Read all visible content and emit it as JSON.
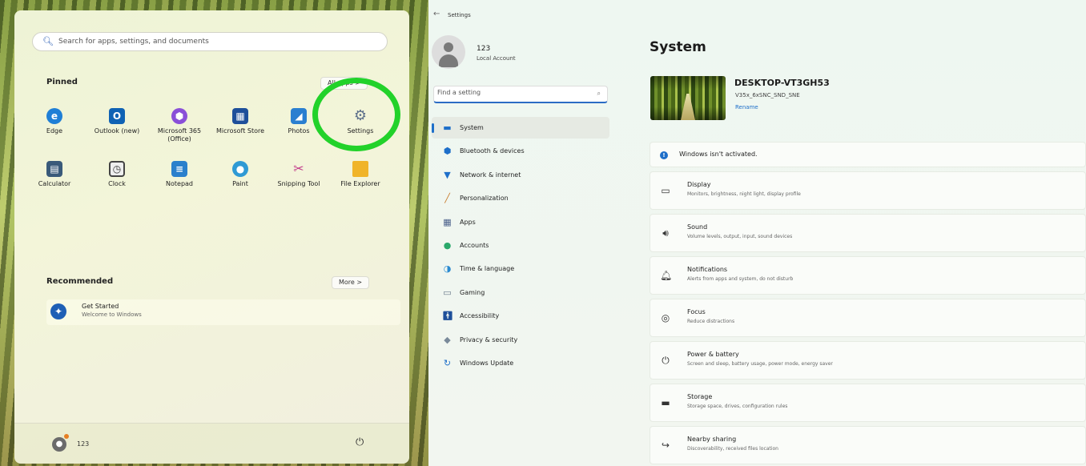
{
  "start_menu": {
    "search_placeholder": "Search for apps, settings, and documents",
    "pinned_title": "Pinned",
    "all_apps_label": "All apps >",
    "pinned_apps": [
      {
        "label": "Edge",
        "icon": "edge-icon",
        "color": "#1f7fd6"
      },
      {
        "label": "Outlook (new)",
        "icon": "outlook-icon",
        "color": "#0f62b4"
      },
      {
        "label": "Microsoft 365 (Office)",
        "icon": "office-icon",
        "color": "#8a4fd8"
      },
      {
        "label": "Microsoft Store",
        "icon": "store-icon",
        "color": "#1e4f9a"
      },
      {
        "label": "Photos",
        "icon": "photos-icon",
        "color": "#2a7fd0"
      },
      {
        "label": "Settings",
        "icon": "gear-icon",
        "color": "#5c6f8a"
      },
      {
        "label": "Calculator",
        "icon": "calculator-icon",
        "color": "#3a5a7a"
      },
      {
        "label": "Clock",
        "icon": "clock-icon",
        "color": "#3b3b3b"
      },
      {
        "label": "Notepad",
        "icon": "notepad-icon",
        "color": "#2b80cc"
      },
      {
        "label": "Paint",
        "icon": "paint-icon",
        "color": "#2f9ad4"
      },
      {
        "label": "Snipping Tool",
        "icon": "snipping-tool-icon",
        "color": "#c23a8a"
      },
      {
        "label": "File Explorer",
        "icon": "folder-icon",
        "color": "#f0b429"
      }
    ],
    "recommended_title": "Recommended",
    "more_label": "More >",
    "recommended_items": [
      {
        "title": "Get Started",
        "subtitle": "Welcome to Windows"
      }
    ],
    "user_name": "123"
  },
  "settings": {
    "window_title": "Settings",
    "profile": {
      "name": "123",
      "type": "Local Account"
    },
    "find_placeholder": "Find a setting",
    "nav": [
      {
        "label": "System",
        "icon": "system-icon",
        "color": "#1e6fc9",
        "active": true
      },
      {
        "label": "Bluetooth & devices",
        "icon": "bluetooth-icon",
        "color": "#1e6fc9"
      },
      {
        "label": "Network & internet",
        "icon": "wifi-icon",
        "color": "#1e6fc9"
      },
      {
        "label": "Personalization",
        "icon": "brush-icon",
        "color": "#c87a2a"
      },
      {
        "label": "Apps",
        "icon": "apps-icon",
        "color": "#4a5f8a"
      },
      {
        "label": "Accounts",
        "icon": "accounts-icon",
        "color": "#2aa86a"
      },
      {
        "label": "Time & language",
        "icon": "globe-icon",
        "color": "#2a8ad0"
      },
      {
        "label": "Gaming",
        "icon": "gaming-icon",
        "color": "#6a7a8a"
      },
      {
        "label": "Accessibility",
        "icon": "accessibility-icon",
        "color": "#1e4f9a"
      },
      {
        "label": "Privacy & security",
        "icon": "shield-icon",
        "color": "#7a8a9a"
      },
      {
        "label": "Windows Update",
        "icon": "update-icon",
        "color": "#1e6fc9"
      }
    ],
    "page_title": "System",
    "device": {
      "name": "DESKTOP-VT3GH53",
      "model": "V35x_6xSNC_SND_SNE",
      "rename_label": "Rename"
    },
    "activation_text": "Windows isn't activated.",
    "rows": [
      {
        "title": "Display",
        "subtitle": "Monitors, brightness, night light, display profile",
        "icon": "display-icon"
      },
      {
        "title": "Sound",
        "subtitle": "Volume levels, output, input, sound devices",
        "icon": "speaker-icon"
      },
      {
        "title": "Notifications",
        "subtitle": "Alerts from apps and system, do not disturb",
        "icon": "bell-icon"
      },
      {
        "title": "Focus",
        "subtitle": "Reduce distractions",
        "icon": "focus-icon"
      },
      {
        "title": "Power & battery",
        "subtitle": "Screen and sleep, battery usage, power mode, energy saver",
        "icon": "power-icon"
      },
      {
        "title": "Storage",
        "subtitle": "Storage space, drives, configuration rules",
        "icon": "storage-icon"
      },
      {
        "title": "Nearby sharing",
        "subtitle": "Discoverability, received files location",
        "icon": "share-icon"
      }
    ]
  }
}
